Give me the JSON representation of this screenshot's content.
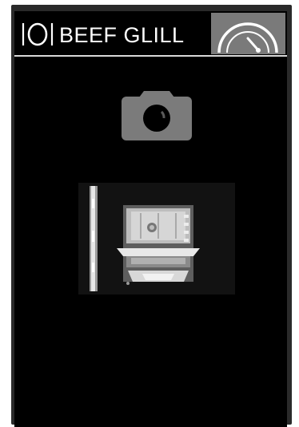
{
  "header": {
    "title": "BEEF GLILL",
    "icons": {
      "plate": "plate-with-cutlery-icon",
      "gauge": "speedometer-gauge-icon"
    }
  },
  "camera": {
    "icon": "camera-icon"
  },
  "preview": {
    "description_icon": "oven-interior-photo"
  },
  "colors": {
    "screen_bg": "#000000",
    "gauge_button_bg": "#7a7a7a",
    "camera_icon": "#7b7b7b",
    "text": "#ffffff"
  }
}
